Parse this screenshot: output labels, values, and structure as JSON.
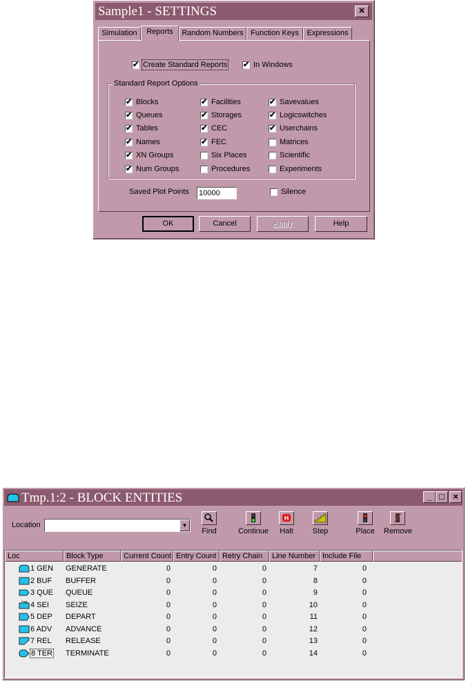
{
  "settings_dialog": {
    "title": "Sample1 - SETTINGS",
    "close_glyph": "×",
    "tabs": [
      "Simulation",
      "Reports",
      "Random Numbers",
      "Function Keys",
      "Expressions"
    ],
    "active_tab": "Reports",
    "create_standard_reports": {
      "label": "Create Standard Reports",
      "checked": true
    },
    "in_windows": {
      "label": "In Windows",
      "checked": true
    },
    "group_label": "Standard Report Options",
    "options": [
      {
        "label": "Blocks",
        "checked": true
      },
      {
        "label": "Facilities",
        "checked": true
      },
      {
        "label": "Savevalues",
        "checked": true
      },
      {
        "label": "Queues",
        "checked": true
      },
      {
        "label": "Storages",
        "checked": true
      },
      {
        "label": "Logicswitches",
        "checked": true
      },
      {
        "label": "Tables",
        "checked": true
      },
      {
        "label": "CEC",
        "checked": true
      },
      {
        "label": "Userchains",
        "checked": true
      },
      {
        "label": "Names",
        "checked": true
      },
      {
        "label": "FEC",
        "checked": true
      },
      {
        "label": "Matrices",
        "checked": false
      },
      {
        "label": "XN Groups",
        "checked": true
      },
      {
        "label": "Six Places",
        "checked": false
      },
      {
        "label": "Scientific",
        "checked": false
      },
      {
        "label": "Num Groups",
        "checked": true
      },
      {
        "label": "Procedures",
        "checked": false
      },
      {
        "label": "Experiments",
        "checked": false
      }
    ],
    "saved_plot_points_label": "Saved Plot Points",
    "saved_plot_points_value": "10000",
    "silence": {
      "label": "Silence",
      "checked": false
    },
    "buttons": {
      "ok": "OK",
      "cancel": "Cancel",
      "apply": "Apply",
      "help": "Help"
    }
  },
  "block_window": {
    "title": "Tmp.1:2  -  BLOCK ENTITIES",
    "controls": {
      "minimize": "_",
      "maximize": "□",
      "close": "×"
    },
    "location_label": "Location",
    "location_value": "",
    "toolbar": [
      "Find",
      "Continue",
      "Halt",
      "Step",
      "Place",
      "Remove"
    ],
    "columns": [
      "Loc",
      "Block Type",
      "Current Count",
      "Entry Count",
      "Retry Chain",
      "Line Number",
      "Include File"
    ],
    "rows": [
      {
        "loc": "1 GEN",
        "type": "GENERATE",
        "current": "0",
        "entry": "0",
        "retry": "0",
        "line": "7",
        "include": "0",
        "icon": "generate-icon"
      },
      {
        "loc": "2 BUF",
        "type": "BUFFER",
        "current": "0",
        "entry": "0",
        "retry": "0",
        "line": "8",
        "include": "0",
        "icon": "buffer-icon"
      },
      {
        "loc": "3 QUE",
        "type": "QUEUE",
        "current": "0",
        "entry": "0",
        "retry": "0",
        "line": "9",
        "include": "0",
        "icon": "queue-icon"
      },
      {
        "loc": "4 SEI",
        "type": "SEIZE",
        "current": "0",
        "entry": "0",
        "retry": "0",
        "line": "10",
        "include": "0",
        "icon": "seize-icon"
      },
      {
        "loc": "5 DEP",
        "type": "DEPART",
        "current": "0",
        "entry": "0",
        "retry": "0",
        "line": "11",
        "include": "0",
        "icon": "depart-icon"
      },
      {
        "loc": "6 ADV",
        "type": "ADVANCE",
        "current": "0",
        "entry": "0",
        "retry": "0",
        "line": "12",
        "include": "0",
        "icon": "advance-icon"
      },
      {
        "loc": "7 REL",
        "type": "RELEASE",
        "current": "0",
        "entry": "0",
        "retry": "0",
        "line": "13",
        "include": "0",
        "icon": "release-icon"
      },
      {
        "loc": "8 TER",
        "type": "TERMINATE",
        "current": "0",
        "entry": "0",
        "retry": "0",
        "line": "14",
        "include": "0",
        "icon": "terminate-icon"
      }
    ]
  },
  "colors": {
    "face": "#c09aab",
    "title_bar": "#8c5a6e",
    "block_icon": "#27c0e8"
  }
}
